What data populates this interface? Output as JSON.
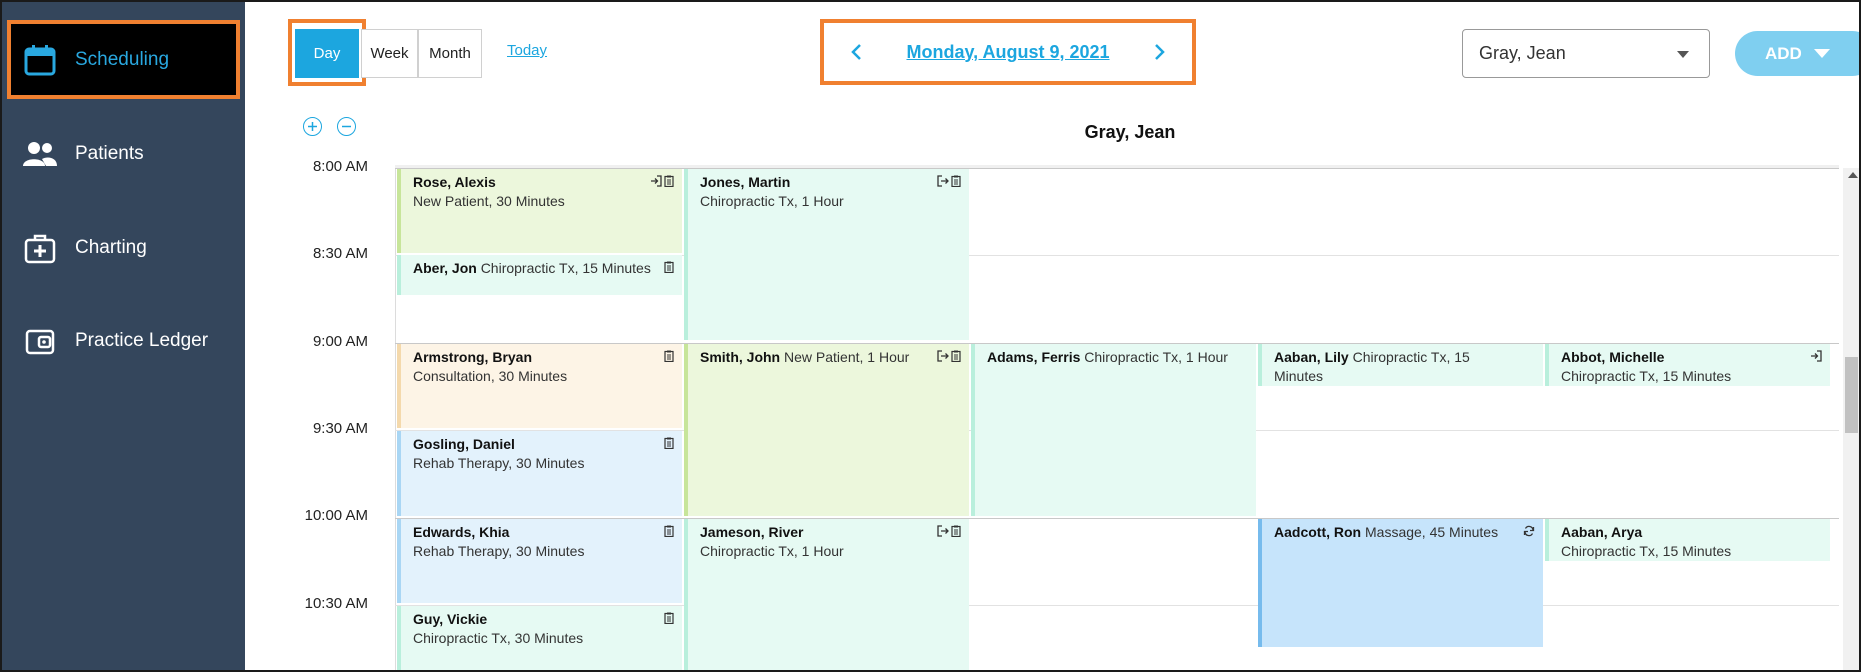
{
  "sidebar": {
    "items": [
      {
        "label": "Scheduling",
        "icon": "calendar-icon",
        "active": true
      },
      {
        "label": "Patients",
        "icon": "people-icon",
        "active": false
      },
      {
        "label": "Charting",
        "icon": "medical-kit-icon",
        "active": false
      },
      {
        "label": "Practice Ledger",
        "icon": "wallet-icon",
        "active": false
      }
    ]
  },
  "toolbar": {
    "views": [
      "Day",
      "Week",
      "Month"
    ],
    "active_view": "Day",
    "today_label": "Today",
    "date_title": "Monday, August 9, 2021",
    "provider_select": "Gray, Jean",
    "add_label": "ADD"
  },
  "calendar": {
    "provider_header": "Gray, Jean",
    "time_labels": [
      "8:00 AM",
      "8:30 AM",
      "9:00 AM",
      "9:30 AM",
      "10:00 AM",
      "10:30 AM"
    ],
    "appointments": [
      {
        "name": "Rose, Alexis",
        "desc": "New Patient, 30 Minutes",
        "icons": [
          "check-in-icon",
          "clipboard-icon"
        ],
        "color": "#ecf7dc"
      },
      {
        "name": "Aber, Jon",
        "desc": "Chiropractic Tx, 15 Minutes",
        "icons": [
          "clipboard-icon"
        ],
        "color": "#e6faf3"
      },
      {
        "name": "Armstrong, Bryan",
        "desc": "Consultation, 30 Minutes",
        "icons": [
          "clipboard-icon"
        ],
        "color": "#fdf4e6"
      },
      {
        "name": "Gosling, Daniel",
        "desc": "Rehab Therapy, 30 Minutes",
        "icons": [
          "clipboard-icon"
        ],
        "color": "#e3f2fc"
      },
      {
        "name": "Edwards, Khia",
        "desc": "Rehab Therapy, 30 Minutes",
        "icons": [
          "clipboard-icon"
        ],
        "color": "#e3f2fc"
      },
      {
        "name": "Guy, Vickie",
        "desc": "Chiropractic Tx, 30 Minutes",
        "icons": [
          "clipboard-icon"
        ],
        "color": "#e6faf3"
      },
      {
        "name": "Jones, Martin",
        "desc": "Chiropractic Tx, 1 Hour",
        "icons": [
          "check-out-icon",
          "clipboard-icon"
        ],
        "color": "#e6faf3"
      },
      {
        "name": "Smith, John",
        "desc": "New Patient, 1 Hour",
        "icons": [
          "check-out-icon",
          "clipboard-icon"
        ],
        "color": "#ecf7dc"
      },
      {
        "name": "Jameson, River",
        "desc": "Chiropractic Tx, 1 Hour",
        "icons": [
          "check-out-icon",
          "clipboard-icon"
        ],
        "color": "#e6faf3"
      },
      {
        "name": "Adams, Ferris",
        "desc": "Chiropractic Tx, 1 Hour",
        "icons": [],
        "color": "#e6faf3"
      },
      {
        "name": "Aaban, Lily",
        "desc": "Chiropractic Tx, 15 Minutes",
        "icons": [],
        "color": "#e6faf3"
      },
      {
        "name": "Aadcott, Ron",
        "desc": "Massage, 45 Minutes",
        "icons": [
          "recurring-icon"
        ],
        "color": "#c6e4fb"
      },
      {
        "name": "Abbot, Michelle",
        "desc": "Chiropractic Tx, 15 Minutes",
        "icons": [
          "check-in-icon"
        ],
        "color": "#e6faf3"
      },
      {
        "name": "Aaban, Arya",
        "desc": "Chiropractic Tx, 15 Minutes",
        "icons": [],
        "color": "#e6faf3"
      }
    ]
  }
}
